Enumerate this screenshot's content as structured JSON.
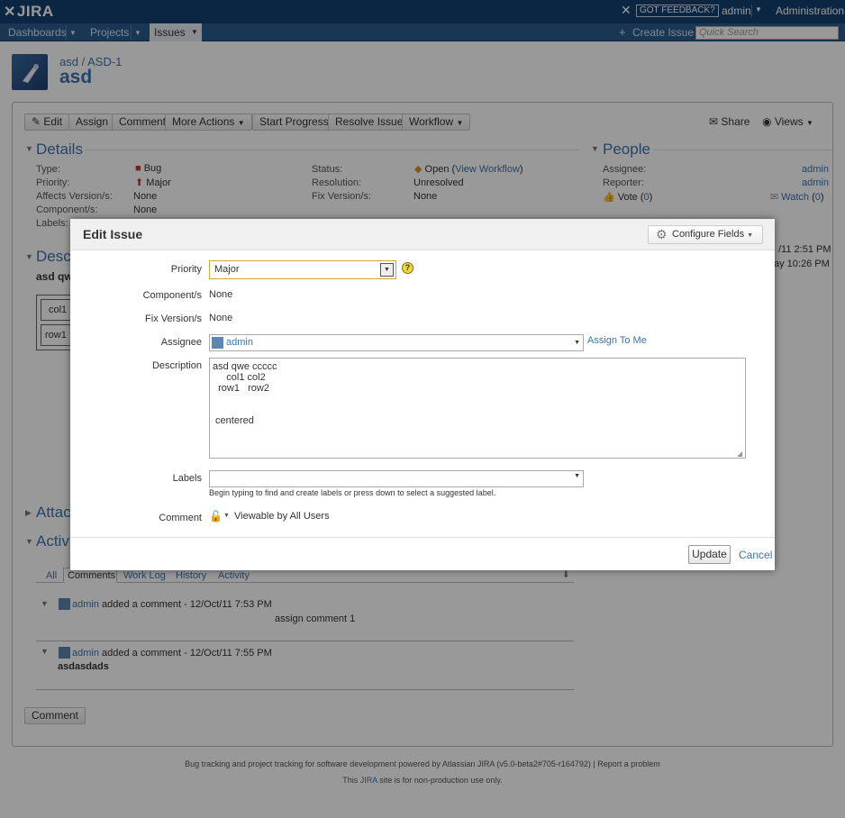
{
  "header": {
    "logo": "JIRA",
    "feedback": "GOT FEEDBACK?",
    "user": "admin",
    "administration": "Administration"
  },
  "nav": {
    "dashboards": "Dashboards",
    "projects": "Projects",
    "issues": "Issues",
    "create_issue": "Create Issue",
    "search_placeholder": "Quick Search"
  },
  "issue": {
    "project": "asd",
    "key": "ASD-1",
    "summary": "asd"
  },
  "toolbar": {
    "edit": "Edit",
    "assign": "Assign",
    "comment": "Comment",
    "more_actions": "More Actions",
    "start_progress": "Start Progress",
    "resolve": "Resolve Issue",
    "workflow": "Workflow",
    "share": "Share",
    "views": "Views"
  },
  "details": {
    "heading": "Details",
    "type_label": "Type:",
    "type": "Bug",
    "priority_label": "Priority:",
    "priority": "Major",
    "affects_label": "Affects Version/s:",
    "affects": "None",
    "component_label": "Component/s:",
    "component": "None",
    "labels_label": "Labels:",
    "status_label": "Status:",
    "status": "Open",
    "view_workflow": "View Workflow",
    "resolution_label": "Resolution:",
    "resolution": "Unresolved",
    "fix_label": "Fix Version/s:",
    "fix": "None"
  },
  "people": {
    "heading": "People",
    "assignee_label": "Assignee:",
    "assignee": "admin",
    "reporter_label": "Reporter:",
    "reporter": "admin",
    "vote": "Vote",
    "vote_count": "0",
    "watch": "Watch",
    "watch_count": "0"
  },
  "dates": {
    "created_fragment": "/11 2:51 PM",
    "updated_fragment": "ay 10:26 PM"
  },
  "description": {
    "heading_fragment": "Desc",
    "text_fragment": "asd qw",
    "cell1": "col1",
    "cell2": "row1"
  },
  "attachments_fragment": "Attac",
  "activity": {
    "heading_fragment": "Activi",
    "tabs": [
      "All",
      "Comments",
      "Work Log",
      "History",
      "Activity"
    ],
    "comments": [
      {
        "author": "admin",
        "meta": "added a comment - 12/Oct/11 7:53 PM",
        "body": "assign comment 1"
      },
      {
        "author": "admin",
        "meta": "added a comment - 12/Oct/11 7:55 PM",
        "body": "asdasdads"
      }
    ],
    "comment_button": "Comment"
  },
  "dialog": {
    "title": "Edit Issue",
    "configure": "Configure Fields",
    "priority_label": "Priority",
    "priority_value": "Major",
    "component_label": "Component/s",
    "component_value": "None",
    "fix_label": "Fix Version/s",
    "fix_value": "None",
    "assignee_label": "Assignee",
    "assignee_value": "admin",
    "assign_to_me": "Assign To Me",
    "description_label": "Description",
    "description_lines": [
      "asd qwe ccccc",
      "     col1 col2",
      "  row1   row2",
      "",
      "",
      " centered"
    ],
    "labels_label": "Labels",
    "labels_hint": "Begin typing to find and create labels or press down to select a suggested label.",
    "comment_label": "Comment",
    "comment_visibility": "Viewable by All Users",
    "update": "Update",
    "cancel": "Cancel"
  },
  "footer": {
    "line1": "Bug tracking and project tracking for software development powered by Atlassian JIRA (v5.0-beta2#705-r164792)  |  Report a problem",
    "line2_pre": "This ",
    "line2_link": "JIRA",
    "line2_post": " site is for non-production use only."
  }
}
